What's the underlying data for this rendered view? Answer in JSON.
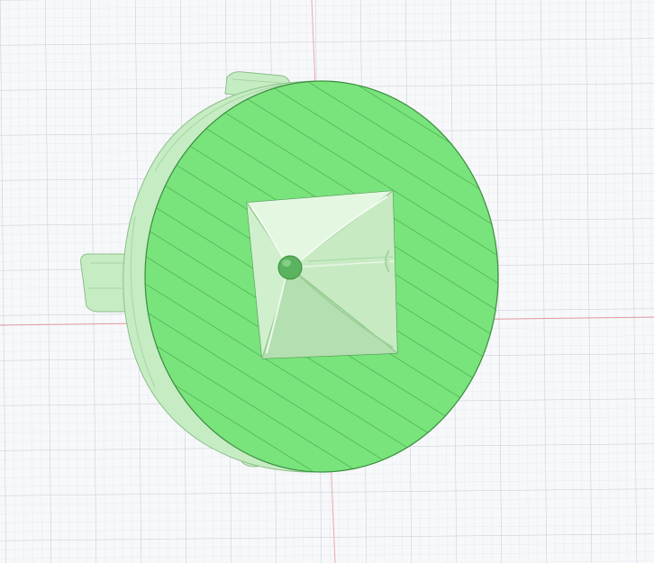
{
  "viewport": {
    "label": "",
    "colors": {
      "background": "#f7f8fa",
      "grid_minor": "#e3e6ec",
      "grid_major": "#c9ced8",
      "axis_x": "#e29aa0",
      "axis_y": "#9db9e3",
      "section_fill": "#79e37c",
      "section_hatch": "#3fa243",
      "body_side": "#c6ecc4",
      "body_edge": "#8cbf8a",
      "cavity_light": "#d9f3d6",
      "cavity_dark": "#a9d8a6"
    }
  },
  "model": {
    "name": "",
    "view_mode": "section-analysis",
    "features": [
      "disc-body",
      "square-cavity",
      "pyramid-ribs",
      "center-ball",
      "mount-tabs"
    ]
  }
}
